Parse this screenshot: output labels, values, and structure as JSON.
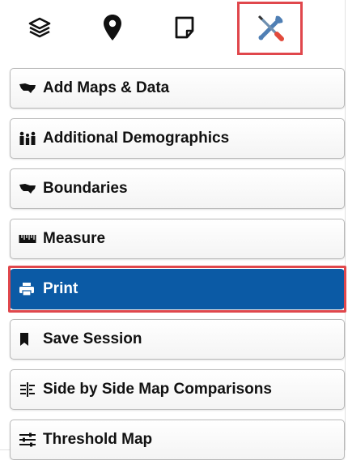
{
  "toolbar": {
    "tabs": [
      {
        "icon": "layers-icon"
      },
      {
        "icon": "map-marker-icon"
      },
      {
        "icon": "note-icon"
      },
      {
        "icon": "tools-icon",
        "active": true
      }
    ],
    "highlight_color": "#e0474c"
  },
  "menu": {
    "items": [
      {
        "icon": "us-map-icon",
        "label": "Add Maps & Data"
      },
      {
        "icon": "people-icon",
        "label": "Additional Demographics"
      },
      {
        "icon": "us-map-icon",
        "label": "Boundaries"
      },
      {
        "icon": "ruler-icon",
        "label": "Measure"
      },
      {
        "icon": "print-icon",
        "label": "Print",
        "active": true
      },
      {
        "icon": "bookmark-icon",
        "label": "Save Session"
      },
      {
        "icon": "side-by-side-icon",
        "label": "Side by Side Map Comparisons"
      },
      {
        "icon": "sliders-icon",
        "label": "Threshold Map"
      }
    ],
    "active_color": "#0b5aa5"
  }
}
